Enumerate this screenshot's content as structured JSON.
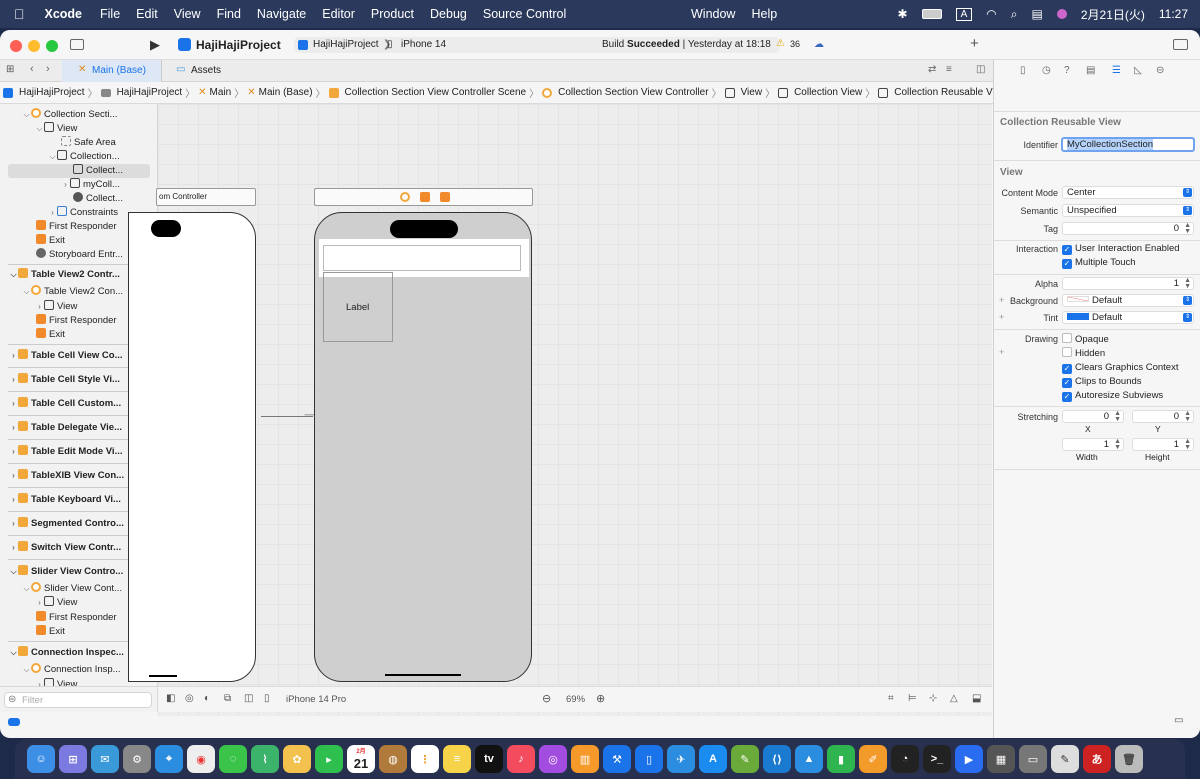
{
  "menubar": {
    "app": "Xcode",
    "menus": [
      "File",
      "Edit",
      "View",
      "Find",
      "Navigate",
      "Editor",
      "Product",
      "Debug",
      "Source Control"
    ],
    "menus_right": [
      "Window",
      "Help"
    ],
    "input_label": "A",
    "date": "2月21日(火)",
    "time": "11:27"
  },
  "toolbar": {
    "project": "HajiHajiProject",
    "scheme_project": "HajiHajiProject",
    "device": "iPhone 14",
    "build_status": "Build",
    "build_result": "Succeeded",
    "build_time": "| Yesterday at 18:18",
    "warnings": "36"
  },
  "tabs": {
    "main": "Main (Base)",
    "assets": "Assets"
  },
  "breadcrumb": [
    "HajiHajiProject",
    "HajiHajiProject",
    "Main",
    "Main (Base)",
    "Collection Section View Controller Scene",
    "Collection Section View Controller",
    "View",
    "Collection View",
    "Collection Reusable View"
  ],
  "navigator": {
    "rows": [
      "Collection Secti...",
      "View",
      "Safe Area",
      "Collection...",
      "Collect...",
      "myColl...",
      "Collect...",
      "Constraints",
      "First Responder",
      "Exit",
      "Storyboard Entr...",
      "Table View2 Contr...",
      "Table View2 Con...",
      "View",
      "First Responder",
      "Exit",
      "Table Cell View Co...",
      "Table Cell Style Vi...",
      "Table Cell Custom...",
      "Table Delegate Vie...",
      "Table Edit Mode Vi...",
      "TableXIB View Con...",
      "Table Keyboard Vi...",
      "Segmented Contro...",
      "Switch View Contr...",
      "Slider View Contro...",
      "Slider View Cont...",
      "View",
      "First Responder",
      "Exit",
      "Connection Inspec...",
      "Connection Insp...",
      "View"
    ],
    "filter_placeholder": "Filter"
  },
  "canvas": {
    "left_scene_title": "om Controller",
    "label_text": "Label",
    "device_config": "iPhone 14 Pro",
    "zoom": "69%"
  },
  "inspector": {
    "title": "Collection Reusable View",
    "identifier_label": "Identifier",
    "identifier_value": "MyCollectionSection",
    "section_view": "View",
    "content_mode_label": "Content Mode",
    "content_mode": "Center",
    "semantic_label": "Semantic",
    "semantic": "Unspecified",
    "tag_label": "Tag",
    "tag": "0",
    "interaction_label": "Interaction",
    "user_interaction": "User Interaction Enabled",
    "multiple_touch": "Multiple Touch",
    "alpha_label": "Alpha",
    "alpha": "1",
    "background_label": "Background",
    "background": "Default",
    "tint_label": "Tint",
    "tint": "Default",
    "drawing_label": "Drawing",
    "opaque": "Opaque",
    "hidden": "Hidden",
    "clears": "Clears Graphics Context",
    "clips": "Clips to Bounds",
    "autoresize": "Autoresize Subviews",
    "stretching_label": "Stretching",
    "x": "0",
    "y": "0",
    "x_label": "X",
    "y_label": "Y",
    "width": "1",
    "height": "1",
    "width_label": "Width",
    "height_label": "Height",
    "tint_color": "#1a73e8"
  },
  "dock": {
    "calendar_day": "21",
    "calendar_month": "2月",
    "tv_label": "tv",
    "hiragana": "あ"
  }
}
